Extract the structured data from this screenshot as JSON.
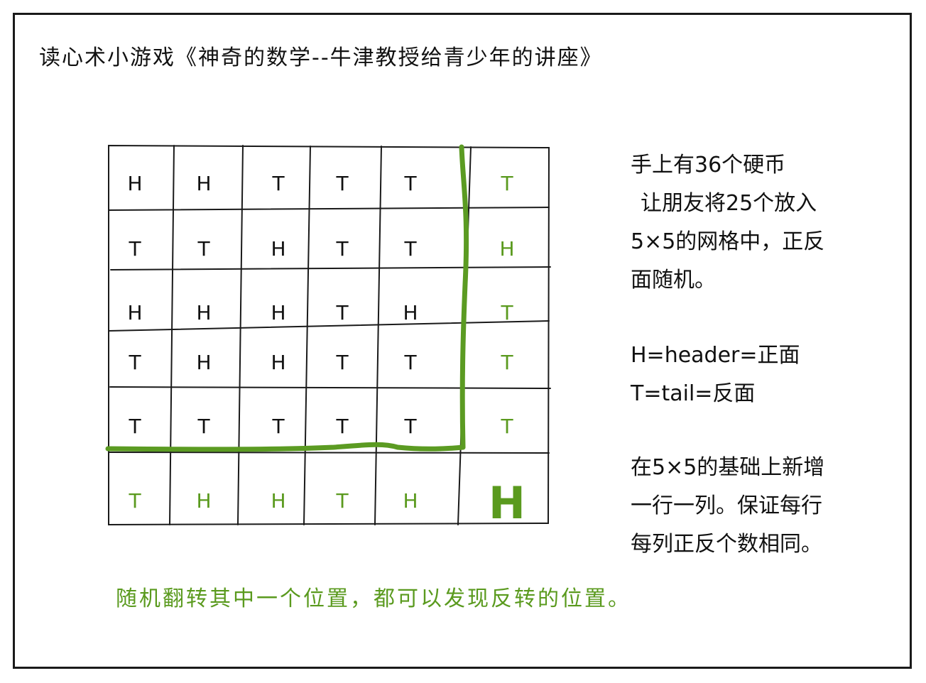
{
  "title": "读心术小游戏《神奇的数学--牛津教授给青少年的讲座》",
  "grid": {
    "rows": [
      [
        "H",
        "H",
        "T",
        "T",
        "T",
        "T"
      ],
      [
        "T",
        "T",
        "H",
        "T",
        "T",
        "H"
      ],
      [
        "H",
        "H",
        "H",
        "T",
        "H",
        "T"
      ],
      [
        "T",
        "H",
        "H",
        "T",
        "T",
        "T"
      ],
      [
        "T",
        "T",
        "T",
        "T",
        "T",
        "T"
      ],
      [
        "T",
        "H",
        "H",
        "T",
        "H",
        "H"
      ]
    ],
    "flipped": {
      "row": 5,
      "col": 5
    }
  },
  "explanation": {
    "line1": "手上有36个硬币",
    "line2": "让朋友将25个放入",
    "line3": "5×5的网格中，正反",
    "line4": "面随机。",
    "h_def": "H=header=正面",
    "t_def": "T=tail=反面",
    "add1": "在5×5的基础上新增",
    "add2": "一行一列。保证每行",
    "add3": "每列正反个数相同。"
  },
  "footer_note": "随机翻转其中一个位置，都可以发现反转的位置。",
  "colors": {
    "ink": "#111111",
    "green": "#5a9a1e",
    "green_line": "#5b9b22"
  }
}
